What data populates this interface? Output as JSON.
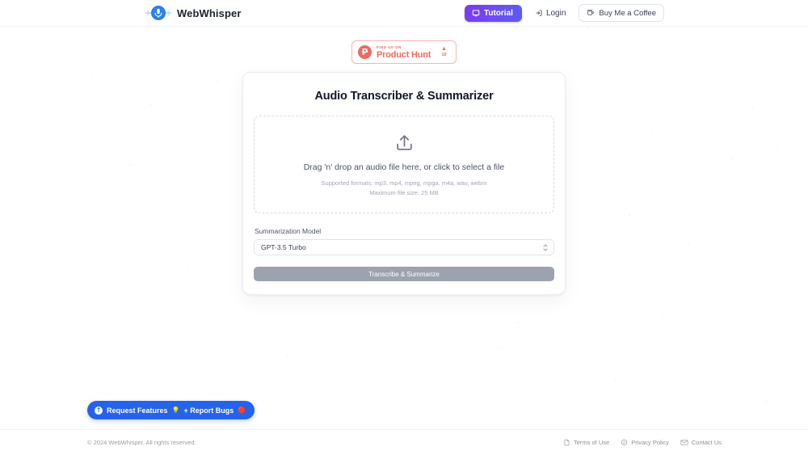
{
  "header": {
    "brand_name": "WebWhisper",
    "brand_logo_icon": "microphone-circle-logo",
    "tutorial_label": "Tutorial",
    "tutorial_icon": "monitor-icon",
    "login_label": "Login",
    "login_icon": "login-arrow-icon",
    "coffee_label": "Buy Me a Coffee",
    "coffee_icon": "coffee-cup-icon"
  },
  "product_hunt": {
    "logo_letter": "P",
    "kicker": "FIND US ON",
    "title": "Product Hunt",
    "arrow": "▲",
    "votes": "10"
  },
  "card": {
    "title": "Audio Transcriber & Summarizer",
    "dropzone": {
      "icon": "upload-icon",
      "main_text": "Drag 'n' drop an audio file here, or click to select a file",
      "formats_text": "Supported formats: mp3, mp4, mpeg, mpga, m4a, wav, webm",
      "maxsize_text": "Maximum file size: 25 MB"
    },
    "model_label": "Summarization Model",
    "model_value": "GPT-3.5 Turbo",
    "model_options": [
      "GPT-3.5 Turbo"
    ],
    "submit_label": "Transcribe & Summarize"
  },
  "feedback": {
    "icon": "info-circle-icon",
    "text_1": "Request Features",
    "emoji_1": "💡",
    "text_2": "+ Report Bugs",
    "emoji_2": "🔴"
  },
  "footer": {
    "copyright": "© 2024 WebWhisper. All rights reserved.",
    "links": [
      {
        "label": "Terms of Use",
        "icon": "document-icon"
      },
      {
        "label": "Privacy Policy",
        "icon": "shield-check-icon"
      },
      {
        "label": "Contact Us",
        "icon": "envelope-icon"
      }
    ]
  },
  "colors": {
    "brand_blue": "#2563eb",
    "tutorial_purple": "#6d4df6",
    "product_hunt_red": "#ef6a5d",
    "submit_disabled_gray": "#9ca3af",
    "page_background": "#ffffff"
  }
}
